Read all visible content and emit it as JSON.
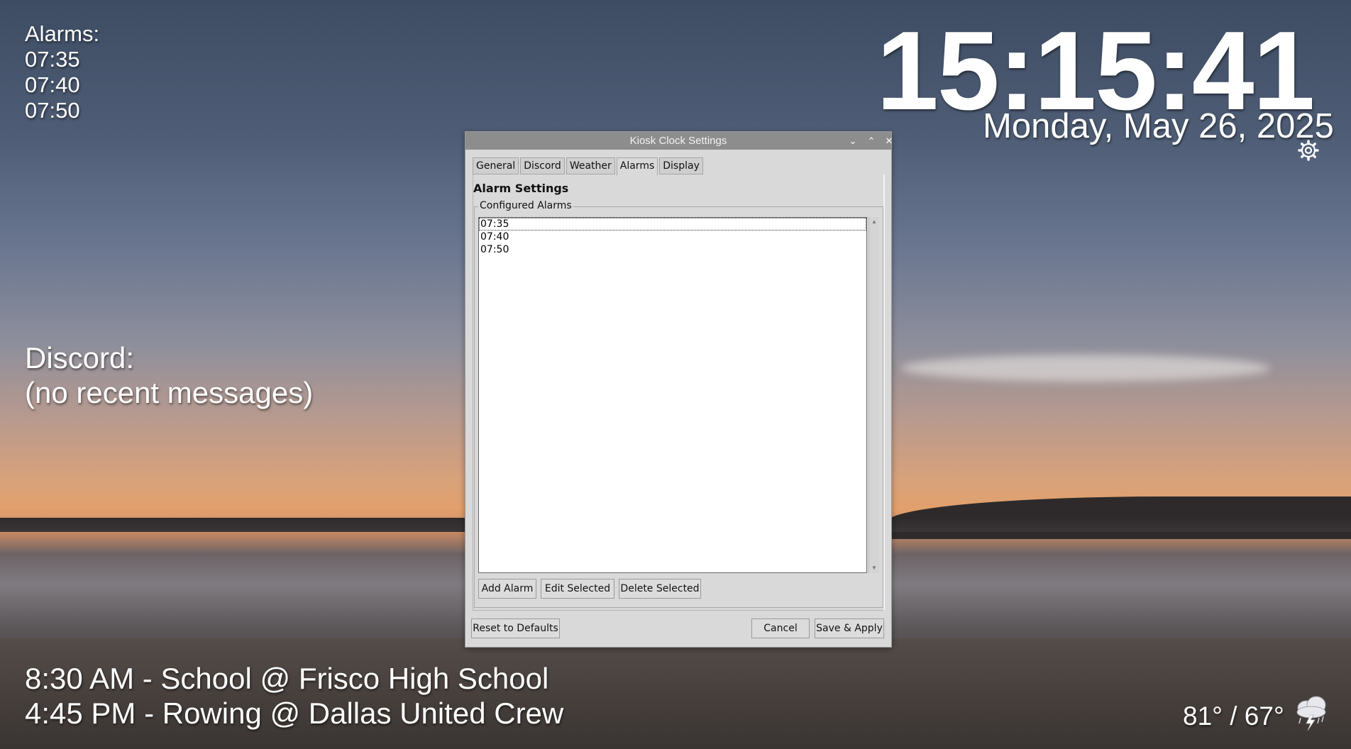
{
  "desktop": {
    "alarms_title": "Alarms:",
    "alarms": [
      "07:35",
      "07:40",
      "07:50"
    ],
    "clock_time": "15:15:41",
    "clock_date": "Monday, May 26, 2025",
    "discord_title": "Discord:",
    "discord_status": "(no recent messages)",
    "events": [
      "8:30 AM - School @ Frisco High School",
      "4:45 PM - Rowing @ Dallas United Crew"
    ],
    "weather_temps": "81° / 67°",
    "weather_icon": "thunderstorm-icon",
    "settings_icon": "gear-icon"
  },
  "dialog": {
    "title": "Kiosk Clock Settings",
    "tabs": [
      "General",
      "Discord",
      "Weather",
      "Alarms",
      "Display"
    ],
    "active_tab": "Alarms",
    "panel_title": "Alarm Settings",
    "group_label": "Configured Alarms",
    "alarm_list": [
      "07:35",
      "07:40",
      "07:50"
    ],
    "buttons": {
      "add": "Add Alarm",
      "edit": "Edit Selected",
      "delete": "Delete Selected",
      "reset": "Reset to Defaults",
      "cancel": "Cancel",
      "save": "Save & Apply"
    }
  }
}
